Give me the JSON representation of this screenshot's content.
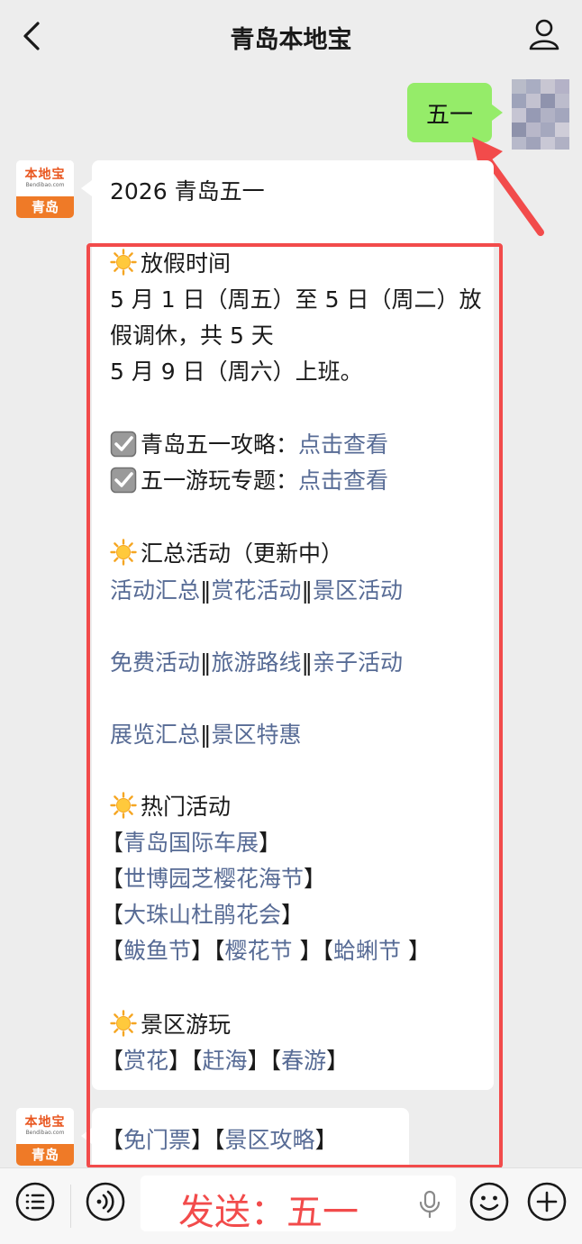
{
  "header": {
    "title": "青岛本地宝",
    "back_icon": "chevron-left-icon",
    "profile_icon": "person-icon"
  },
  "outgoing": {
    "text": "五一"
  },
  "bot": {
    "avatar_brand": "本地宝",
    "avatar_url": "Bendibao.com",
    "avatar_city": "青岛"
  },
  "message": {
    "heading": "2026 青岛五一",
    "holiday_title": "放假时间",
    "holiday_line1": "5 月 1 日（周五）至 5 日（周二）放",
    "holiday_line2": "假调休，共 5 天",
    "holiday_line3": "5 月 9 日（周六）上班。",
    "guide_label": "青岛五一攻略：",
    "guide_link": "点击查看",
    "topic_label": "五一游玩专题：",
    "topic_link": "点击查看",
    "summary_title": "汇总活动（更新中）",
    "summary_row1": [
      "活动汇总",
      "赏花活动",
      "景区活动"
    ],
    "summary_row2": [
      "免费活动",
      "旅游路线",
      "亲子活动"
    ],
    "summary_row3": [
      "展览汇总",
      "景区特惠"
    ],
    "separator": "‖",
    "hot_title": "热门活动",
    "hot_items": [
      "青岛国际车展",
      "世博园芝樱花海节",
      "大珠山杜鹃花会"
    ],
    "hot_row4": [
      "鲅鱼节",
      "樱花节 ",
      "蛤蜊节 "
    ],
    "scenic_title": "景区游玩",
    "scenic_items": [
      "赏花",
      "赶海",
      "春游"
    ],
    "second_items": [
      "免门票",
      "景区攻略"
    ]
  },
  "input_bar": {
    "text": "发送：五一",
    "menu_icon": "list-menu-icon",
    "voice_icon": "voice-icon",
    "mic_icon": "mic-icon",
    "emoji_icon": "emoji-icon",
    "plus_icon": "plus-icon"
  },
  "colors": {
    "link": "#576b95",
    "annotation_red": "#f24b4b",
    "bubble_green": "#95ec69"
  }
}
